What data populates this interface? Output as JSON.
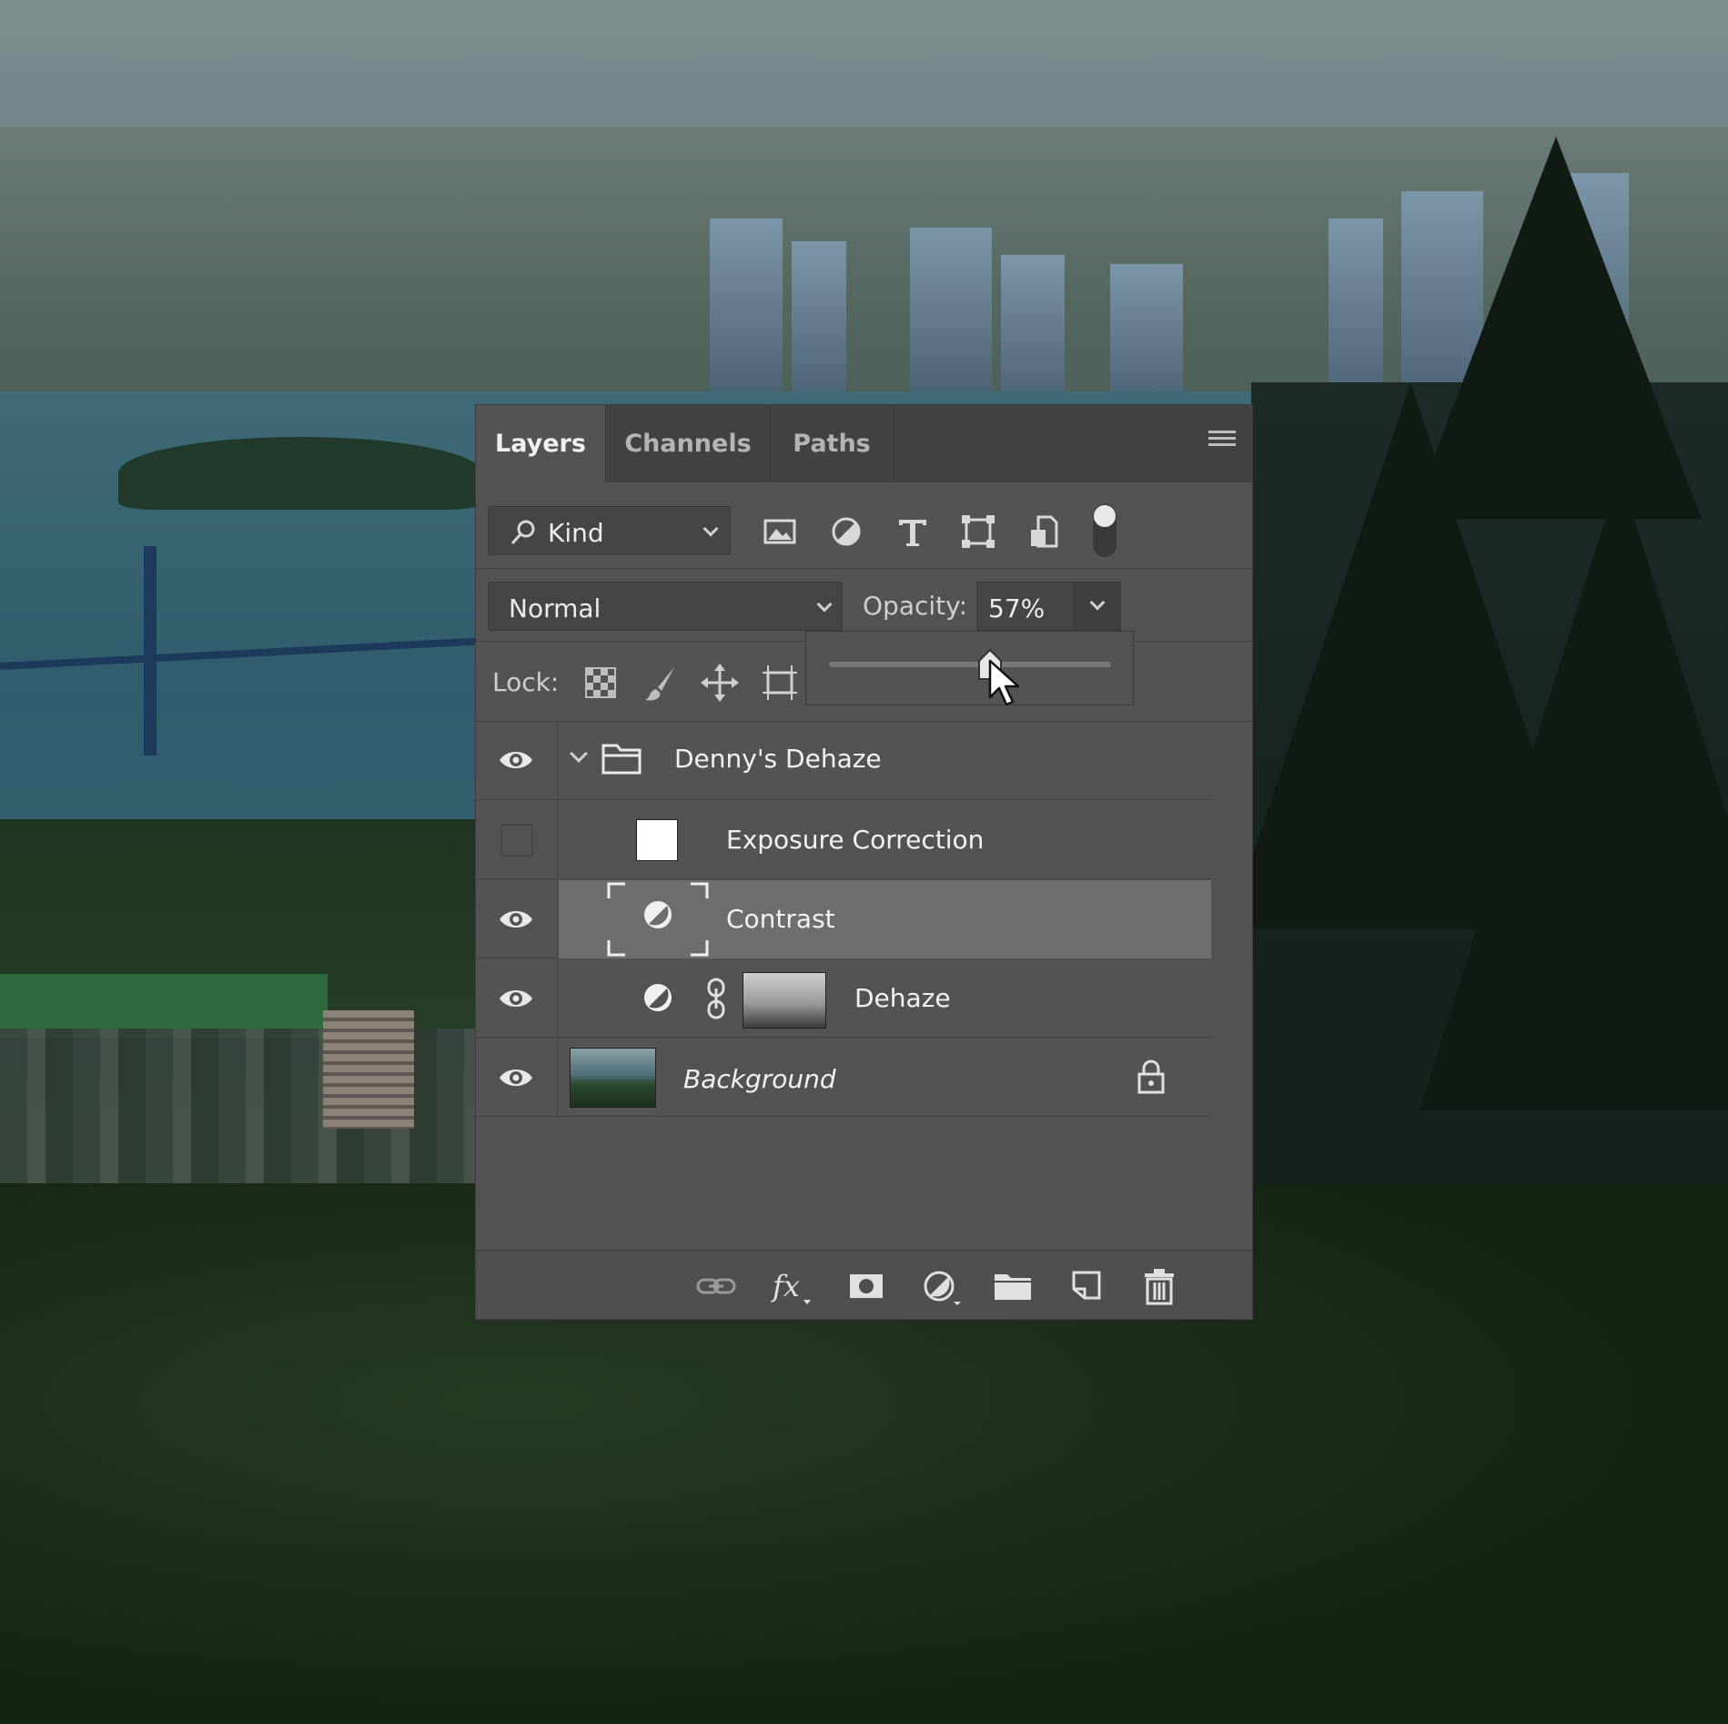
{
  "panel": {
    "tabs": [
      {
        "label": "Layers",
        "active": true
      },
      {
        "label": "Channels",
        "active": false
      },
      {
        "label": "Paths",
        "active": false
      }
    ],
    "menu_icon": "panel-menu-icon"
  },
  "filter": {
    "kind_label": "Kind",
    "icons": [
      "pixel-layer-filter-icon",
      "adjustment-layer-filter-icon",
      "type-layer-filter-icon",
      "shape-layer-filter-icon",
      "smart-object-filter-icon",
      "filter-toggle-icon"
    ]
  },
  "blend": {
    "mode": "Normal",
    "opacity_label": "Opacity:",
    "opacity_value": "57%",
    "opacity_slider_fraction": 0.57
  },
  "lock": {
    "label": "Lock:",
    "icons": [
      "lock-transparent-pixels-icon",
      "lock-image-pixels-icon",
      "lock-position-icon",
      "lock-artboard-icon"
    ]
  },
  "layers": [
    {
      "name": "Denny's Dehaze",
      "type": "group",
      "visible": true,
      "expanded": true
    },
    {
      "name": "Exposure Correction",
      "type": "fill",
      "visible": false
    },
    {
      "name": "Contrast",
      "type": "adjustment",
      "visible": true,
      "selected": true
    },
    {
      "name": "Dehaze",
      "type": "adjustment-with-mask",
      "visible": true
    },
    {
      "name": "Background",
      "type": "image",
      "visible": true,
      "locked": true
    }
  ],
  "footer": {
    "icons": [
      "link-layers-icon",
      "fx-icon",
      "add-mask-icon",
      "new-adjustment-icon",
      "new-group-icon",
      "new-layer-icon",
      "delete-layer-icon"
    ],
    "fx_label": "fx"
  },
  "colors": {
    "panel_bg": "#535353",
    "tab_bar_bg": "#424242",
    "selected_row_bg": "#6e6e6e"
  }
}
